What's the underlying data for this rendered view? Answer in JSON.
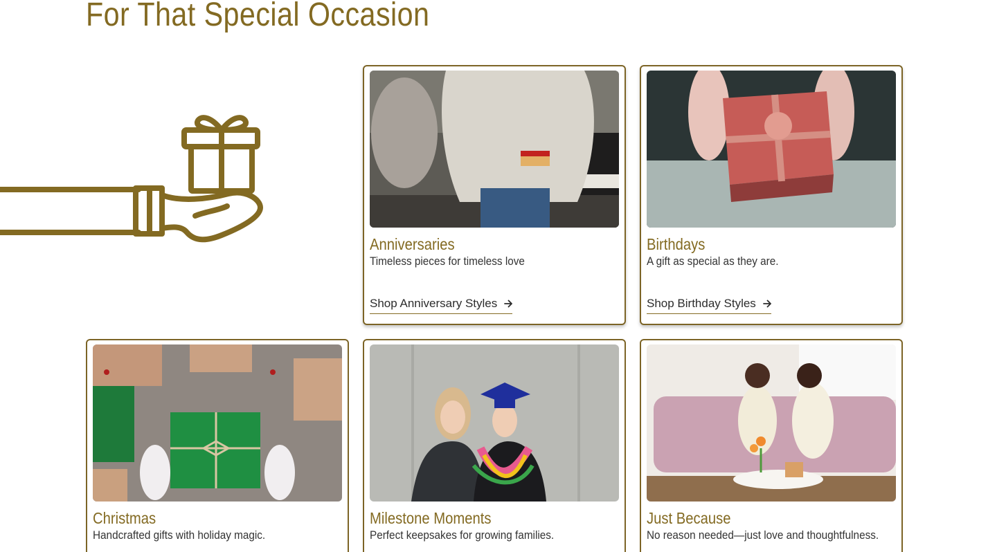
{
  "section": {
    "heading": "For That Special Occasion"
  },
  "colors": {
    "accent": "#836a22",
    "border": "#7c6426",
    "text": "#333333"
  },
  "illustration": {
    "icon": "gift-in-hand-icon"
  },
  "cards": [
    {
      "title": "Anniversaries",
      "description": "Timeless pieces for timeless love",
      "link_label": "Shop Anniversary Styles",
      "image": "anniversary-photo"
    },
    {
      "title": "Birthdays",
      "description": "A gift as special as they are.",
      "link_label": "Shop Birthday Styles",
      "image": "birthday-photo"
    },
    {
      "title": "Christmas",
      "description": "Handcrafted gifts with holiday magic.",
      "image": "christmas-photo"
    },
    {
      "title": "Milestone Moments",
      "description": "Perfect keepsakes for growing families.",
      "image": "graduation-photo"
    },
    {
      "title": "Just Because",
      "description": "No reason needed—just love and thoughtfulness.",
      "image": "friends-photo"
    }
  ]
}
